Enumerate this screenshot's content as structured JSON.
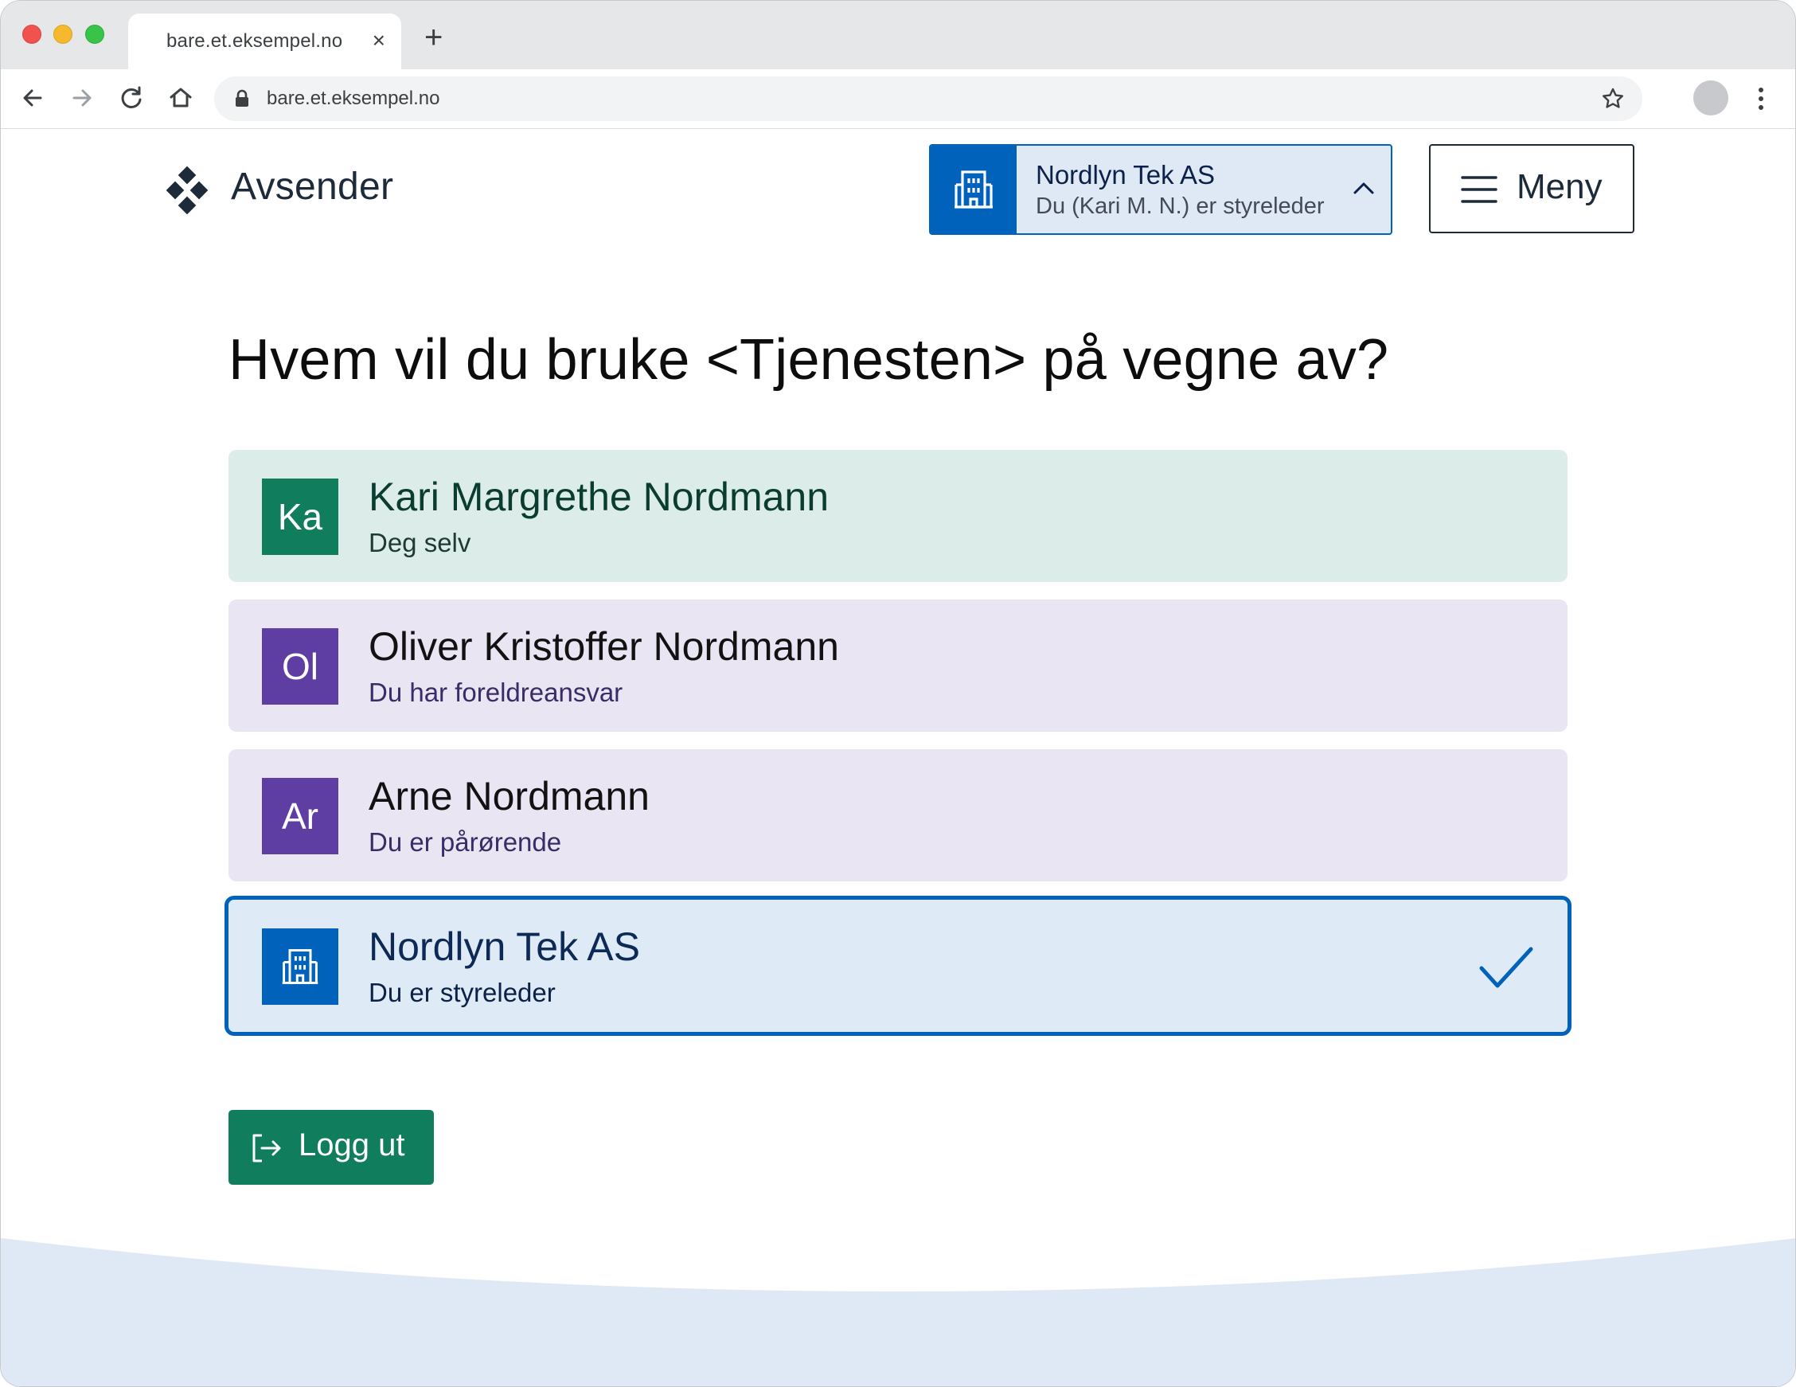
{
  "browser": {
    "tab_title": "bare.et.eksempel.no",
    "tab_close": "×",
    "new_tab": "+",
    "url": "bare.et.eksempel.no"
  },
  "header": {
    "brand": "Avsender",
    "account": {
      "name": "Nordlyn Tek AS",
      "role": "Du (Kari M. N.) er styreleder"
    },
    "menu_label": "Meny"
  },
  "main": {
    "heading": "Hvem vil du bruke <Tjenesten> på vegne av?",
    "options": [
      {
        "initials": "Ka",
        "name": "Kari Margrethe Nordmann",
        "relation": "Deg selv",
        "type": "self"
      },
      {
        "initials": "Ol",
        "name": "Oliver Kristoffer Nordmann",
        "relation": "Du har foreldreansvar",
        "type": "person"
      },
      {
        "initials": "Ar",
        "name": "Arne Nordmann",
        "relation": "Du er pårørende",
        "type": "person"
      },
      {
        "initials": "",
        "name": "Nordlyn Tek AS",
        "relation": "Du er styreleder",
        "type": "organization",
        "selected": true
      }
    ],
    "logout_label": "Logg ut"
  },
  "colors": {
    "primary_blue": "#0062ba",
    "green": "#107e5c",
    "purple": "#5e3ea3"
  },
  "icons": [
    "back-icon",
    "forward-icon",
    "reload-icon",
    "home-icon",
    "lock-icon",
    "star-icon",
    "kebab-icon",
    "building-icon",
    "chevron-up-icon",
    "hamburger-icon",
    "checkmark-icon",
    "logout-icon"
  ]
}
